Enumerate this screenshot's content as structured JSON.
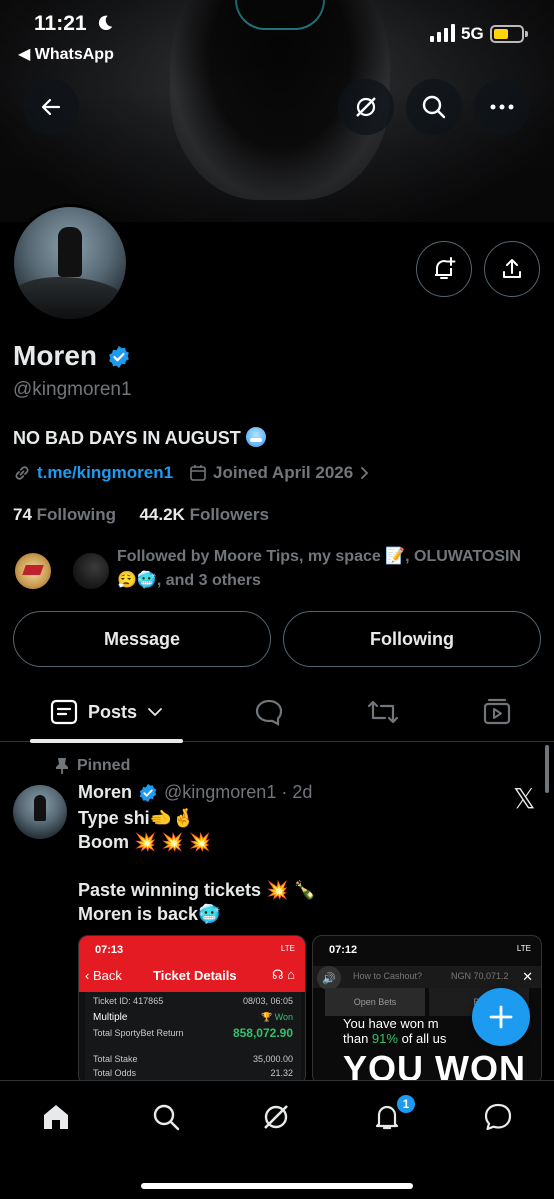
{
  "status_bar": {
    "time": "11:21",
    "back_app": "◀ WhatsApp",
    "network": "5G",
    "battery_color": "#ffd60a"
  },
  "header_icons": [
    "back-arrow-icon",
    "grok-icon",
    "search-icon",
    "more-icon"
  ],
  "profile": {
    "name": "Moren",
    "handle": "@kingmoren1",
    "bio": "NO BAD DAYS IN AUGUST",
    "link": "t.me/kingmoren1",
    "joined": "Joined April 2026",
    "following_count": "74",
    "following_label": "Following",
    "followers_count": "44.2K",
    "followers_label": "Followers",
    "followed_by": "Followed by Moore Tips, my space 📝, OLUWATOSIN 😮‍💨🥶, and 3 others"
  },
  "actions": {
    "message": "Message",
    "following": "Following"
  },
  "tabs": {
    "posts": "Posts"
  },
  "post": {
    "pinned_label": "Pinned",
    "author": "Moren",
    "handle_time": "@kingmoren1 · 2d",
    "lines": [
      "Type shi🫲🤞",
      "Boom 💥 💥 💥",
      "",
      "Paste winning tickets 💥 🍾",
      "Moren is back🥶"
    ],
    "media1": {
      "time": "07:13",
      "status": "LTE",
      "back": "Back",
      "title": "Ticket Details",
      "ticket_id": "Ticket ID: 417865",
      "date": "08/03, 06:05",
      "bet_type": "Multiple",
      "status_won": "Won",
      "return_label": "Total SportyBet Return",
      "return_value": "858,072.90",
      "stake_label": "Total Stake",
      "stake_value": "35,000.00",
      "odds_label": "Total Odds",
      "odds_value": "21.32"
    },
    "media2": {
      "time": "07:12",
      "status": "LTE",
      "how_to": "How to Cashout?",
      "ngn": "NGN 70,071.2",
      "open_bets": "Open Bets",
      "tab2": "Ba",
      "msg_a": "You have won m",
      "msg_b": "than ",
      "msg_pct": "91%",
      "msg_c": " of all us",
      "headline": "YOU WON"
    }
  },
  "bottom_nav": [
    "home-icon",
    "search-icon",
    "grok-icon",
    "notifications-icon",
    "messages-icon"
  ],
  "notifications_badge": "1",
  "colors": {
    "accent": "#1d9bf0",
    "background": "#000000",
    "secondary_text": "#71767b",
    "sportybet_red": "#e41b23",
    "won_green": "#35c06a"
  }
}
